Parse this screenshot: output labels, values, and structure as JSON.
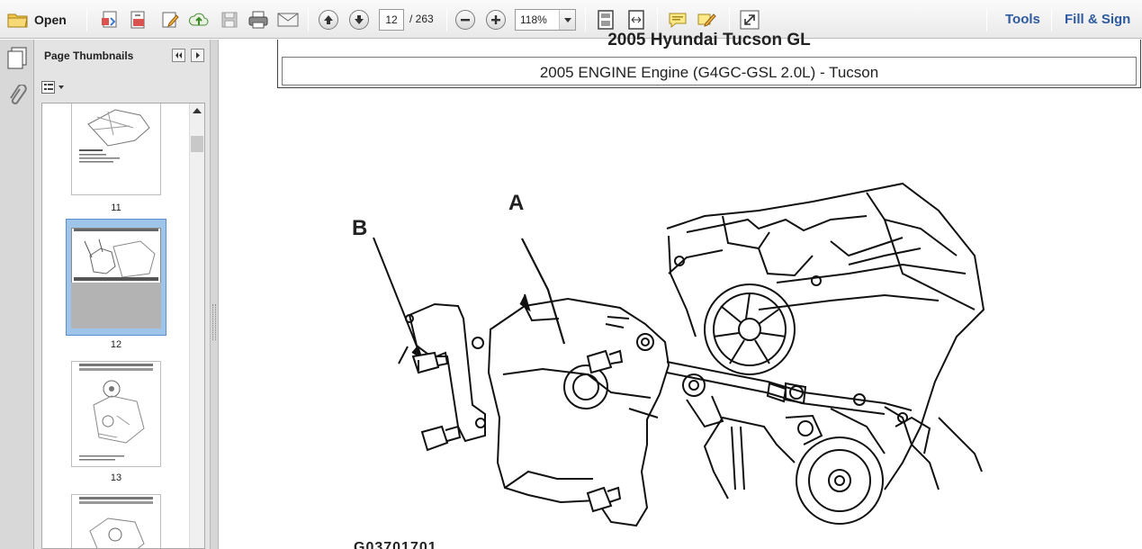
{
  "toolbar": {
    "open_label": "Open",
    "current_page": "12",
    "total_pages": "/ 263",
    "zoom": "118%",
    "tools_label": "Tools",
    "fill_sign_label": "Fill & Sign"
  },
  "panel": {
    "title": "Page Thumbnails",
    "thumbnails": [
      {
        "page": "11"
      },
      {
        "page": "12",
        "selected": true
      },
      {
        "page": "13"
      }
    ]
  },
  "document": {
    "title": "2005 Hyundai Tucson GL",
    "subtitle": "2005 ENGINE Engine (G4GC-GSL 2.0L) - Tucson",
    "label_a": "A",
    "label_b": "B",
    "figure_caption": "G03701701"
  },
  "colors": {
    "link": "#2d5aa0",
    "selected_thumb": "#9fc4ea"
  }
}
